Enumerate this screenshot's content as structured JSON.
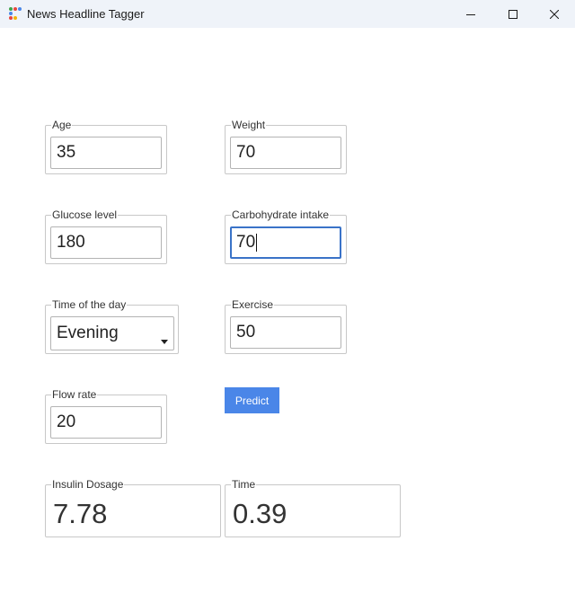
{
  "window": {
    "title": "News Headline Tagger",
    "icon_colors": [
      "#3ea34a",
      "#e8453c",
      "#4a86e8",
      "#f4b400"
    ]
  },
  "form": {
    "age": {
      "label": "Age",
      "value": "35"
    },
    "weight": {
      "label": "Weight",
      "value": "70"
    },
    "glucose": {
      "label": "Glucose level",
      "value": "180"
    },
    "carbs": {
      "label": "Carbohydrate intake",
      "value": "70"
    },
    "time_of_day": {
      "label": "Time of the day",
      "value": "Evening"
    },
    "exercise": {
      "label": "Exercise",
      "value": "50"
    },
    "flow_rate": {
      "label": "Flow rate",
      "value": "20"
    }
  },
  "predict_label": "Predict",
  "results": {
    "insulin": {
      "label": "Insulin Dosage",
      "value": "7.78"
    },
    "time": {
      "label": "Time",
      "value": "0.39"
    }
  },
  "colors": {
    "accent": "#4a86e8",
    "focus_border": "#3a73c8",
    "titlebar": "#eff3f9"
  }
}
